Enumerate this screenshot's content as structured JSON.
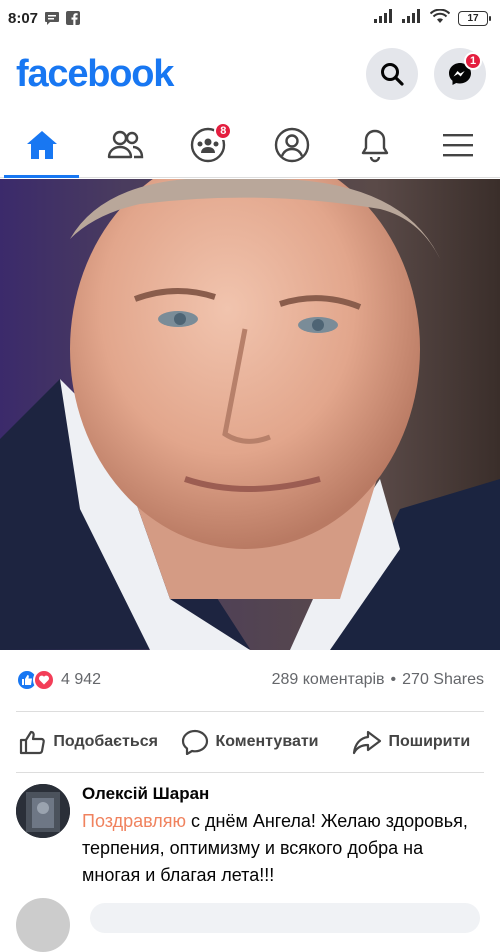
{
  "status_bar": {
    "time": "8:07",
    "battery": "17"
  },
  "header": {
    "logo": "facebook",
    "messenger_badge": "1"
  },
  "tabs": {
    "groups_badge": "8"
  },
  "post": {
    "reaction_count": "4 942",
    "comments": "289 коментарів",
    "separator": "•",
    "shares": "270 Shares",
    "actions": {
      "like": "Подобається",
      "comment": "Коментувати",
      "share": "Поширити"
    }
  },
  "comment": {
    "author": "Олексій Шаран",
    "tag": "Поздравляю",
    "text": " с днём Ангела! Желаю здоровья, терпения, оптимизму и всякого добра на многая и благая лета!!!"
  },
  "colors": {
    "brand": "#1877f2",
    "badge": "#e41e3f",
    "tag": "#f0825e"
  }
}
